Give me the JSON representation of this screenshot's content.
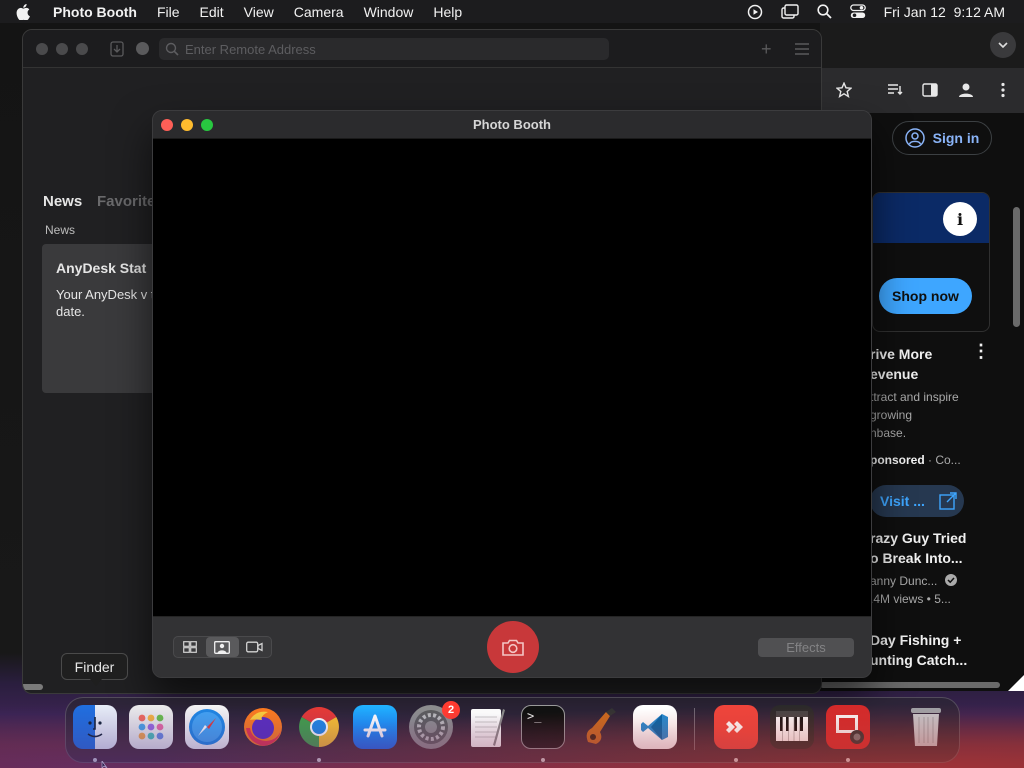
{
  "menubar": {
    "app_name": "Photo Booth",
    "menus": [
      "File",
      "Edit",
      "View",
      "Camera",
      "Window",
      "Help"
    ],
    "datetime": "Fri Jan 12  9:12 AM",
    "status_icons": [
      "screen-record-icon",
      "display-icon",
      "spotlight-search-icon",
      "control-center-icon"
    ]
  },
  "anydesk": {
    "address_placeholder": "Enter Remote Address",
    "tab_news": "News",
    "tab_favorites": "Favorite",
    "news_label": "News",
    "card_title": "AnyDesk Stat",
    "card_body": "Your AnyDesk v to date."
  },
  "photobooth": {
    "title": "Photo Booth",
    "effects_label": "Effects",
    "view_modes": [
      "grid-view-icon",
      "single-photo-icon",
      "video-icon"
    ],
    "selected_view": "single-photo-icon",
    "shutter_color": "#c8383a"
  },
  "chrome": {
    "sign_in": "Sign in",
    "shop_now": "Shop now",
    "ad_title": "rive More evenue",
    "ad_title_l1": "rive More",
    "ad_title_l2": "evenue",
    "ad_desc_l1": "ttract and inspire",
    "ad_desc_l2": "growing",
    "ad_desc_l3": "nbase.",
    "sponsored": "ponsored",
    "sponsored_suffix": "· Co...",
    "visit": "Visit ...",
    "video_title_l1": "razy Guy Tried",
    "video_title_l2": "o Break Into...",
    "video_channel": "anny Dunc...",
    "video_stats": ".4M views  • 5...",
    "video2_title_l1": "Day Fishing +",
    "video2_title_l2": "unting Catch..."
  },
  "tooltip": "Finder",
  "dock": {
    "apps": [
      "Finder",
      "Launchpad",
      "Safari",
      "Firefox",
      "Google Chrome",
      "App Store",
      "System Settings",
      "TextEdit",
      "Terminal",
      "GarageBand",
      "Visual Studio Code",
      "AnyDesk",
      "Piano",
      "Photo Booth",
      "Trash"
    ],
    "settings_badge": "2"
  }
}
